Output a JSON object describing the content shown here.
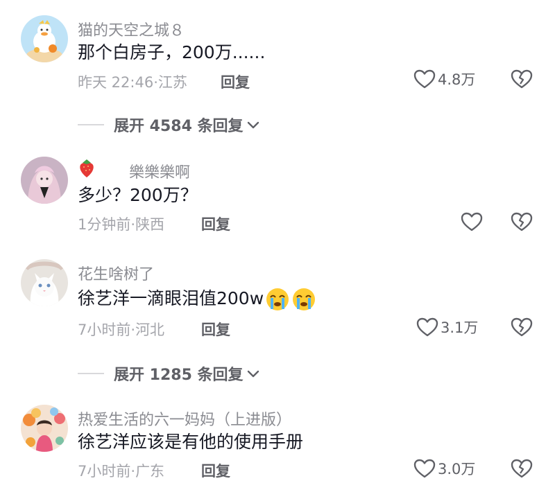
{
  "comments": [
    {
      "username": "猫的天空之城８",
      "text": "那个白房子，200万......",
      "time": "昨天 22:46",
      "location": "江苏",
      "reply_label": "回复",
      "like_count": "4.8万",
      "avatar_icon": "duck-avatar-icon"
    },
    {
      "username": "樂樂樂啊",
      "badge_icon": "strawberry-icon",
      "text": "多少？200万？",
      "time": "1分钟前",
      "location": "陕西",
      "reply_label": "回复",
      "like_count": "",
      "avatar_icon": "anime-girl-avatar-icon"
    },
    {
      "username": "花生啥树了",
      "text": "徐艺洋一滴眼泪值200w",
      "emojis": [
        "crying-face-icon",
        "crying-face-icon"
      ],
      "time": "7小时前",
      "location": "河北",
      "reply_label": "回复",
      "like_count": "3.1万",
      "avatar_icon": "white-cat-avatar-icon"
    },
    {
      "username": "热爱生活的六一妈妈（上进版）",
      "text": "徐艺洋应该是有他的使用手册",
      "time": "7小时前",
      "location": "广东",
      "reply_label": "回复",
      "like_count": "3.0万",
      "avatar_icon": "party-balloons-avatar-icon"
    }
  ],
  "expand_replies": [
    {
      "label": "展开 4584 条回复"
    },
    {
      "label": "展开 1285 条回复"
    }
  ],
  "separator": "·",
  "colors": {
    "text": "#161823",
    "username": "#8a8b91",
    "meta": "#a4a5ab",
    "action": "#5f6066",
    "icon": "#5f6066"
  }
}
